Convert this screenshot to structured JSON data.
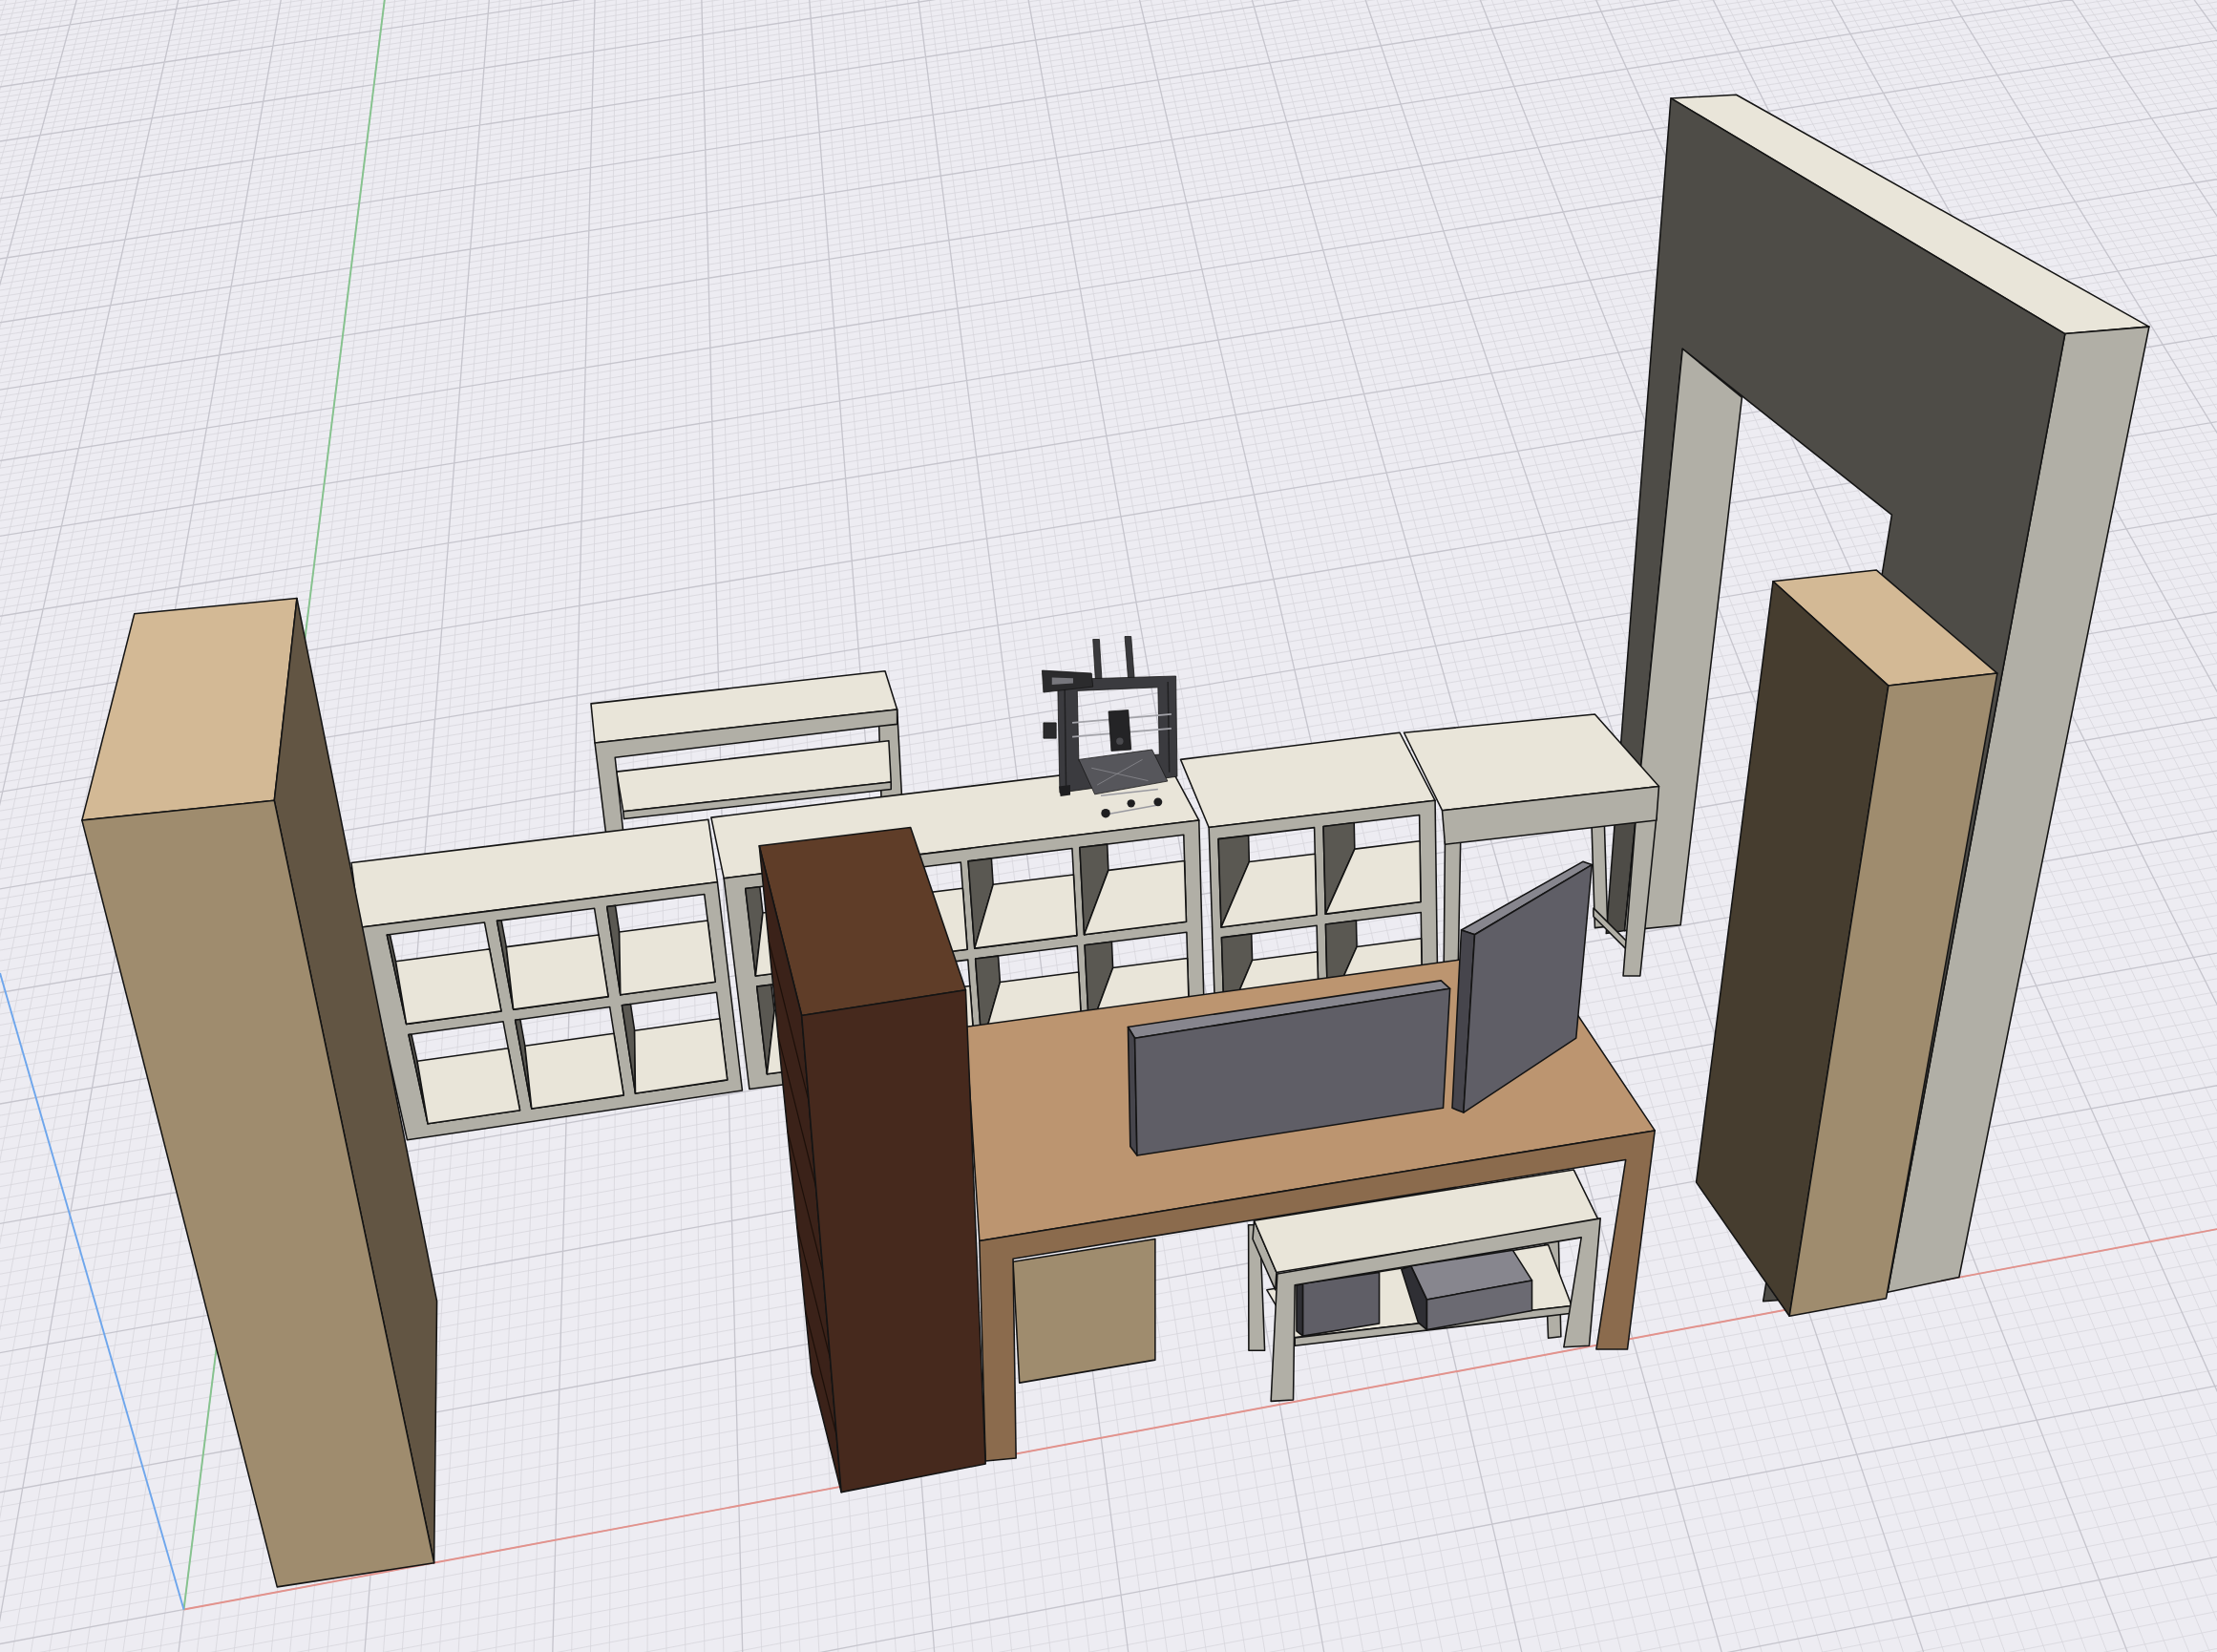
{
  "viewport": {
    "axes": [
      {
        "kind": "x",
        "color": "#e3928c"
      },
      {
        "kind": "y",
        "color": "#86c38e"
      },
      {
        "kind": "z",
        "color": "#6ea6ec"
      }
    ]
  },
  "objects": [
    {
      "kind": "door-frame"
    },
    {
      "kind": "side-table"
    },
    {
      "kind": "side-table"
    },
    {
      "kind": "cube-shelf"
    },
    {
      "kind": "cube-shelf"
    },
    {
      "kind": "cube-shelf"
    },
    {
      "kind": "printer"
    },
    {
      "kind": "tall-cabinet"
    },
    {
      "kind": "pedestal"
    },
    {
      "kind": "bench",
      "contents": [
        {
          "kind": "storage-box"
        },
        {
          "kind": "storage-box"
        }
      ]
    },
    {
      "kind": "desk"
    },
    {
      "kind": "monitor"
    },
    {
      "kind": "monitor"
    },
    {
      "kind": "bookcase"
    },
    {
      "kind": "tall-cabinet"
    }
  ]
}
